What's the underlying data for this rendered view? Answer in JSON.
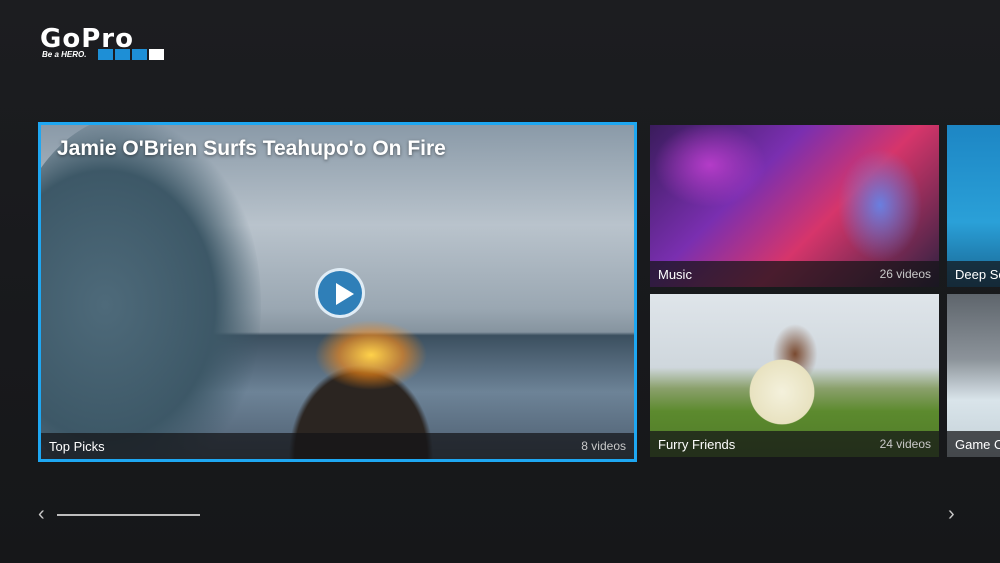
{
  "brand": {
    "logo_text": "GoPro",
    "tagline": "Be a HERO.",
    "square_colors": [
      "#1e8fd6",
      "#1e8fd6",
      "#1e8fd6",
      "#ffffff"
    ]
  },
  "featured": {
    "title": "Jamie O'Brien Surfs Teahupo'o On Fire",
    "category": "Top Picks",
    "count": "8 videos",
    "icon": "play-icon",
    "focus_color": "#1ea7f2"
  },
  "tiles": [
    {
      "label": "Music",
      "count": "26 videos"
    },
    {
      "label": "Deep Se",
      "count": ""
    },
    {
      "label": "Furry Friends",
      "count": "24 videos"
    },
    {
      "label": "Game On",
      "count": ""
    }
  ],
  "navigation": {
    "prev_icon": "chevron-left-icon",
    "next_icon": "chevron-right-icon",
    "prev_glyph": "‹",
    "next_glyph": "›"
  }
}
